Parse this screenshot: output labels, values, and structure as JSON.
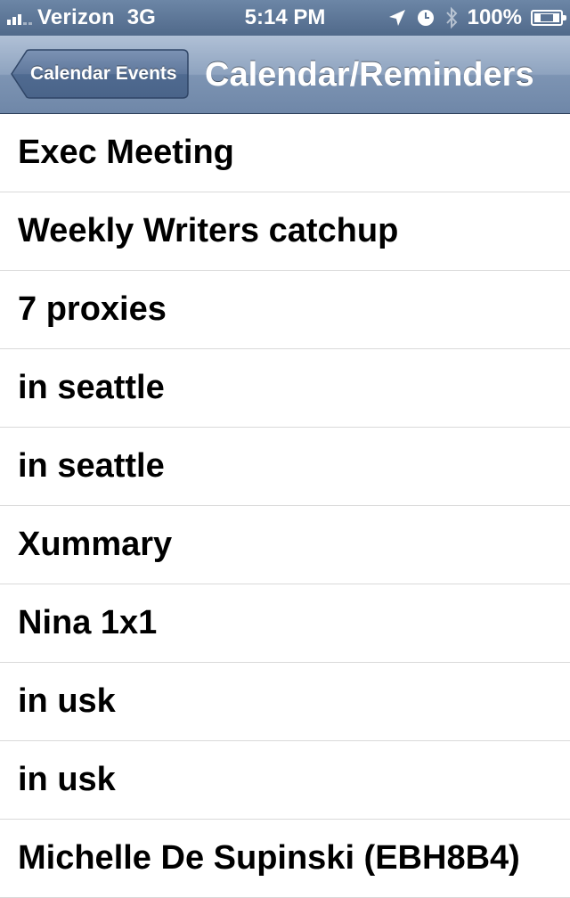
{
  "status_bar": {
    "carrier": "Verizon",
    "network": "3G",
    "time": "5:14 PM",
    "battery": "100%",
    "icons": [
      "signal-icon",
      "location-arrow-icon",
      "alarm-clock-icon",
      "bluetooth-icon",
      "battery-charging-icon"
    ]
  },
  "nav": {
    "back_label": "Calendar Events",
    "title": "Calendar/Reminders"
  },
  "list": {
    "items": [
      "Exec Meeting",
      "Weekly Writers catchup",
      "7 proxies",
      "in seattle",
      "in seattle",
      "Xummary",
      "Nina 1x1",
      "in usk",
      "in usk",
      "Michelle De Supinski (EBH8B4)"
    ]
  },
  "colors": {
    "nav_bar": "#7d94b3",
    "status_bar": "#5a7394",
    "separator": "#d9d9d9",
    "text": "#000000"
  }
}
